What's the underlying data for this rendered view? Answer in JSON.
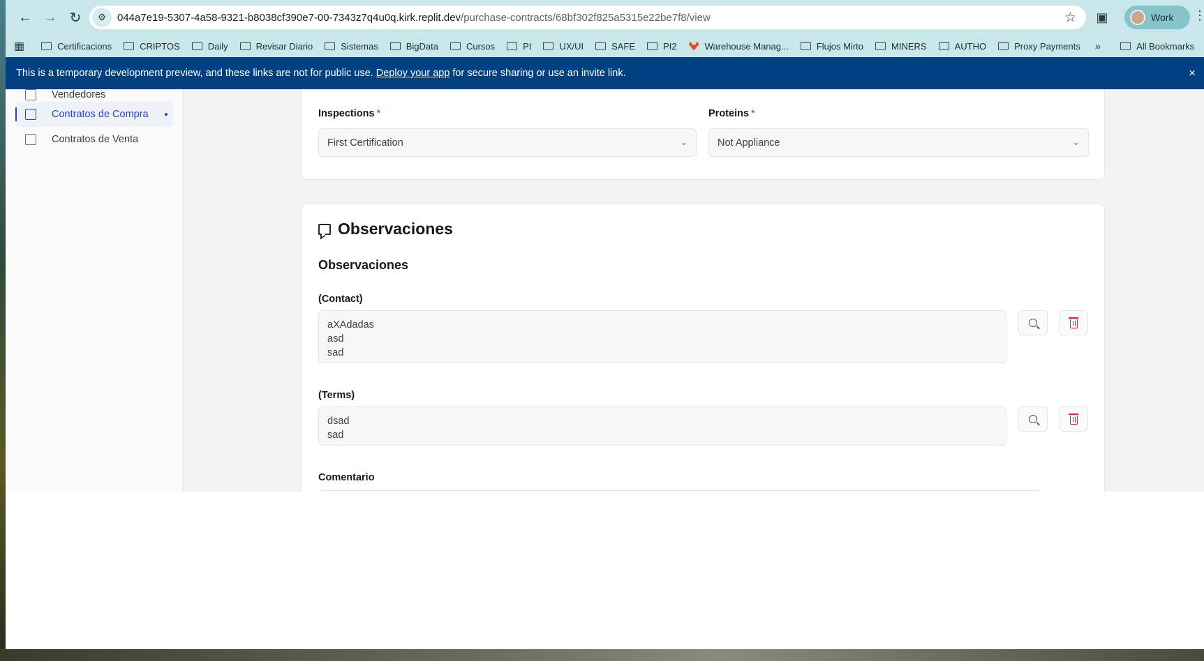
{
  "browser": {
    "url_host": "044a7e19-5307-4a58-9321-b8038cf390e7-00-7343z7q4u0q.kirk.replit.dev",
    "url_path": "/purchase-contracts/68bf302f825a5315e22be7f8/view",
    "profile_label": "Work",
    "icons": {
      "back": "arrow-left-icon",
      "forward": "arrow-right-icon",
      "reload": "reload-icon",
      "bookmark": "star-icon",
      "extensions": "puzzle-icon",
      "menu": "kebab-menu-icon"
    }
  },
  "bookmarks": {
    "items": [
      {
        "label": "Certificacions",
        "icon": "folder-icon"
      },
      {
        "label": "CRIPTOS",
        "icon": "folder-icon"
      },
      {
        "label": "Daily",
        "icon": "folder-icon"
      },
      {
        "label": "Revisar Diario",
        "icon": "folder-icon"
      },
      {
        "label": "Sistemas",
        "icon": "folder-icon"
      },
      {
        "label": "BigData",
        "icon": "folder-icon"
      },
      {
        "label": "Cursos",
        "icon": "folder-icon"
      },
      {
        "label": "PI",
        "icon": "folder-icon"
      },
      {
        "label": "UX/UI",
        "icon": "folder-icon"
      },
      {
        "label": "SAFE",
        "icon": "folder-icon"
      },
      {
        "label": "PI2",
        "icon": "folder-icon"
      },
      {
        "label": "Warehouse Manag...",
        "icon": "gitlab-icon"
      },
      {
        "label": "Flujos Mirto",
        "icon": "folder-icon"
      },
      {
        "label": "MINERS",
        "icon": "folder-icon"
      },
      {
        "label": "AUTHO",
        "icon": "folder-icon"
      },
      {
        "label": "Proxy Payments",
        "icon": "folder-icon"
      }
    ],
    "more": "»",
    "all_bookmarks": "All Bookmarks"
  },
  "banner": {
    "text_before": "This is a temporary development preview, and these links are not for public use.",
    "link": "Deploy your app",
    "text_after": "for secure sharing or use an invite link.",
    "close": "×"
  },
  "sidebar": {
    "items": [
      {
        "label": "Vendedores",
        "icon": "cart-icon",
        "active": false
      },
      {
        "label": "Contratos de Compra",
        "icon": "document-icon",
        "active": true
      },
      {
        "label": "Contratos de Venta",
        "icon": "receipt-icon",
        "active": false
      }
    ]
  },
  "form": {
    "inspections": {
      "label": "Inspections",
      "required": "*",
      "value": "First Certification"
    },
    "proteins": {
      "label": "Proteins",
      "required": "*",
      "value": "Not Appliance"
    }
  },
  "observaciones": {
    "title": "Observaciones",
    "subtitle": "Observaciones",
    "contact": {
      "label": "(Contact)",
      "lines": [
        "aXAdadas",
        "asd",
        "sad"
      ]
    },
    "terms": {
      "label": "(Terms)",
      "lines": [
        "dsad",
        "sad"
      ]
    },
    "comentario": {
      "label": "Comentario"
    }
  },
  "colors": {
    "banner": "#004182",
    "accent": "#2447b8",
    "required": "#dc2626",
    "chrome": "#c9e7ea"
  }
}
